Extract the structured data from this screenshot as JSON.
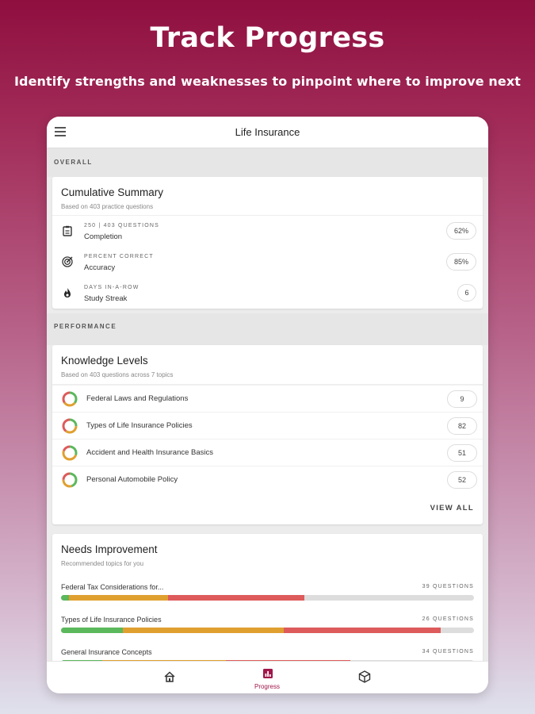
{
  "hero": {
    "title": "Track Progress",
    "subtitle": "Identify strengths and weaknesses to pinpoint where to improve next"
  },
  "appbar": {
    "title": "Life Insurance",
    "menu_icon": "hamburger-menu-icon"
  },
  "overall": {
    "section_label": "OVERALL",
    "card_title": "Cumulative Summary",
    "card_sub": "Based on 403 practice questions",
    "stats": [
      {
        "icon": "clipboard-icon",
        "kicker": "250 | 403 QUESTIONS",
        "label": "Completion",
        "value": "62%"
      },
      {
        "icon": "target-icon",
        "kicker": "PERCENT CORRECT",
        "label": "Accuracy",
        "value": "85%"
      },
      {
        "icon": "flame-icon",
        "kicker": "DAYS IN-A-ROW",
        "label": "Study Streak",
        "value": "6"
      }
    ]
  },
  "performance": {
    "section_label": "PERFORMANCE",
    "card_title": "Knowledge Levels",
    "card_sub": "Based on 403 questions across 7 topics",
    "topics": [
      {
        "name": "Federal Laws and Regulations",
        "count": "9",
        "ring": [
          0.35,
          0.3,
          0.35
        ]
      },
      {
        "name": "Types of Life Insurance Policies",
        "count": "82",
        "ring": [
          0.25,
          0.35,
          0.4
        ]
      },
      {
        "name": "Accident and Health Insurance  Basics",
        "count": "51",
        "ring": [
          0.3,
          0.5,
          0.2
        ]
      },
      {
        "name": "Personal Automobile Policy",
        "count": "52",
        "ring": [
          0.45,
          0.3,
          0.25
        ]
      }
    ],
    "view_all": "VIEW ALL"
  },
  "needs": {
    "card_title": "Needs Improvement",
    "card_sub": "Recommended topics for you",
    "items": [
      {
        "name": "Federal Tax Considerations for...",
        "count": "39 QUESTIONS",
        "segments": [
          0.02,
          0.24,
          0.33
        ]
      },
      {
        "name": "Types of Life Insurance Policies",
        "count": "26 QUESTIONS",
        "segments": [
          0.15,
          0.39,
          0.38
        ]
      },
      {
        "name": "General Insurance Concepts",
        "count": "34 QUESTIONS",
        "segments": [
          0.1,
          0.3,
          0.3
        ]
      }
    ]
  },
  "nav": {
    "items": [
      {
        "icon": "home-icon",
        "label": ""
      },
      {
        "icon": "progress-icon",
        "label": "Progress"
      },
      {
        "icon": "cube-icon",
        "label": ""
      }
    ]
  },
  "colors": {
    "green": "#5cb85c",
    "orange": "#e0a030",
    "red": "#de5b5b",
    "brand": "#a0174b"
  }
}
